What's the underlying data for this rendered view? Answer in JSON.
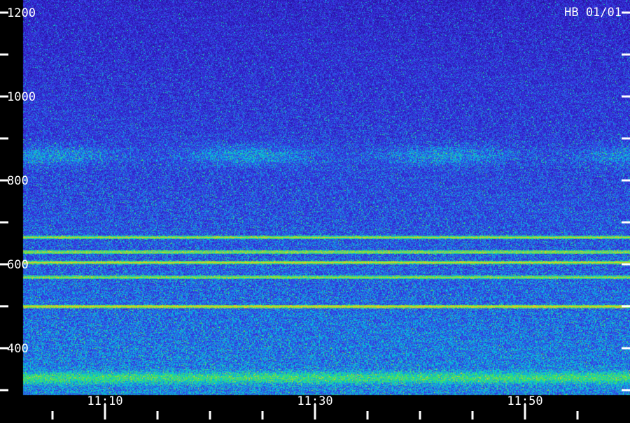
{
  "chart_data": {
    "type": "heatmap",
    "title": "HB 01/01",
    "xlabel": "",
    "ylabel": "",
    "y_ticks": [
      {
        "value": 1200,
        "label": "1200"
      },
      {
        "value": 1000,
        "label": "1000"
      },
      {
        "value": 800,
        "label": "800"
      },
      {
        "value": 600,
        "label": "600"
      },
      {
        "value": 400,
        "label": "400"
      }
    ],
    "x_ticks": [
      {
        "value": "11:10",
        "label": "11:10"
      },
      {
        "value": "11:30",
        "label": "11:30"
      },
      {
        "value": "11:50",
        "label": "11:50"
      }
    ],
    "ylim": [
      300,
      1200
    ],
    "x_minor_tick_interval_minutes": 5,
    "y_minor_tick_interval": 100,
    "colormap": [
      "#1a0a5c",
      "#2d14b4",
      "#3a3ae8",
      "#00c8e0",
      "#48e848",
      "#e8c828"
    ],
    "background_color": "#000000",
    "label_color": "#ffffff",
    "series": [
      {
        "y": 665,
        "intensity": 0.7
      },
      {
        "y": 630,
        "intensity": 0.75
      },
      {
        "y": 605,
        "intensity": 0.8
      },
      {
        "y": 570,
        "intensity": 0.65
      },
      {
        "y": 500,
        "intensity": 0.9
      }
    ],
    "features": [
      {
        "type": "diffuse_band",
        "y": 860,
        "intensity": 0.45
      },
      {
        "type": "low_frequency_emission",
        "y": 330,
        "intensity": 0.6
      }
    ]
  }
}
